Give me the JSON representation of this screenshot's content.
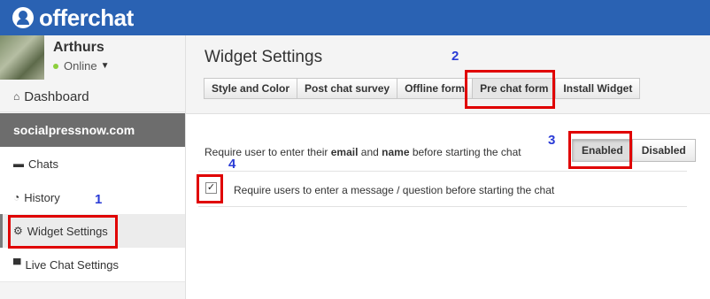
{
  "brand": {
    "name": "offerchat",
    "logo_icon": "chat-user-icon"
  },
  "user": {
    "name": "Arthurs",
    "status": "Online",
    "status_color": "#8ccf3c"
  },
  "sidebar": {
    "dashboard": "Dashboard",
    "site": "socialpressnow.com",
    "items": [
      {
        "label": "Chats",
        "icon": "chat-bubble-icon"
      },
      {
        "label": "History",
        "icon": "clock-icon"
      },
      {
        "label": "Widget Settings",
        "icon": "gear-icon"
      },
      {
        "label": "Live Chat Settings",
        "icon": "window-icon"
      }
    ]
  },
  "main": {
    "title": "Widget Settings",
    "tabs": [
      "Style and Color",
      "Post chat survey",
      "Offline form",
      "Pre chat form",
      "Install Widget"
    ],
    "active_tab": "Pre chat form",
    "require_text": {
      "part1": "Require user to enter their ",
      "email": "email",
      "part2": " and ",
      "name": "name",
      "part3": " before starting the chat"
    },
    "toggle": {
      "enabled": "Enabled",
      "disabled": "Disabled",
      "selected": "Enabled"
    },
    "message_option": {
      "label": "Require users to enter a message / question before starting the chat",
      "checked": true
    }
  },
  "annotations": [
    "1",
    "2",
    "3",
    "4"
  ],
  "colors": {
    "topbar": "#2a62b3",
    "annotation_box": "#e00000",
    "annotation_number": "#2a3bd6"
  }
}
